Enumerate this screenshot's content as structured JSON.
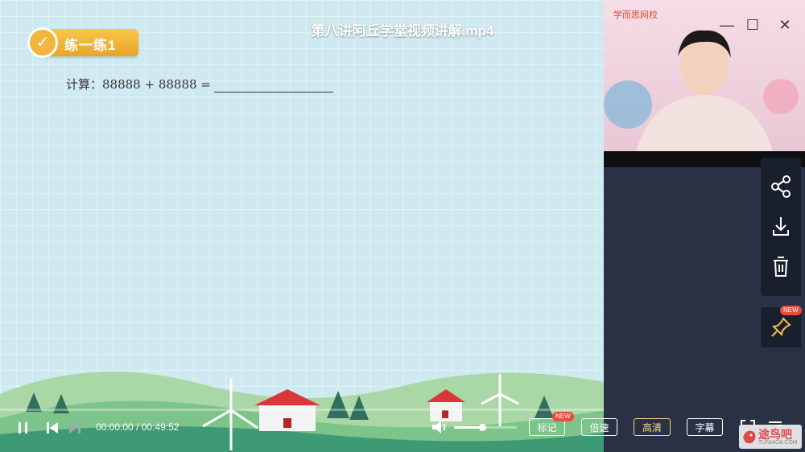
{
  "window": {
    "title": "第八讲阿丘学堂视频讲解.mp4",
    "minimize": "—",
    "maximize": "☐",
    "close": "✕"
  },
  "lesson": {
    "badge_label": "练一练1",
    "question_text": "计算：88888 + 88888 ="
  },
  "player": {
    "time_current": "00:00:00",
    "time_separator": " / ",
    "time_total": "00:49:52",
    "progress_fraction": 0.0,
    "volume_fraction": 0.45,
    "buttons": {
      "mark": "标记",
      "speed": "倍速",
      "quality": "高清",
      "subtitle": "字幕"
    },
    "new_tag": "NEW"
  },
  "sidebar": {
    "school_label": "学而思网校",
    "pin_new_tag": "NEW"
  },
  "watermark": {
    "text": "途鸟吧",
    "sub": "TUNIAO8.COM"
  },
  "colors": {
    "stage_bg": "#cfe9f0",
    "badge": "#f3b53b",
    "panel_bg": "#2a3145",
    "new_tag": "#e74c3c"
  }
}
